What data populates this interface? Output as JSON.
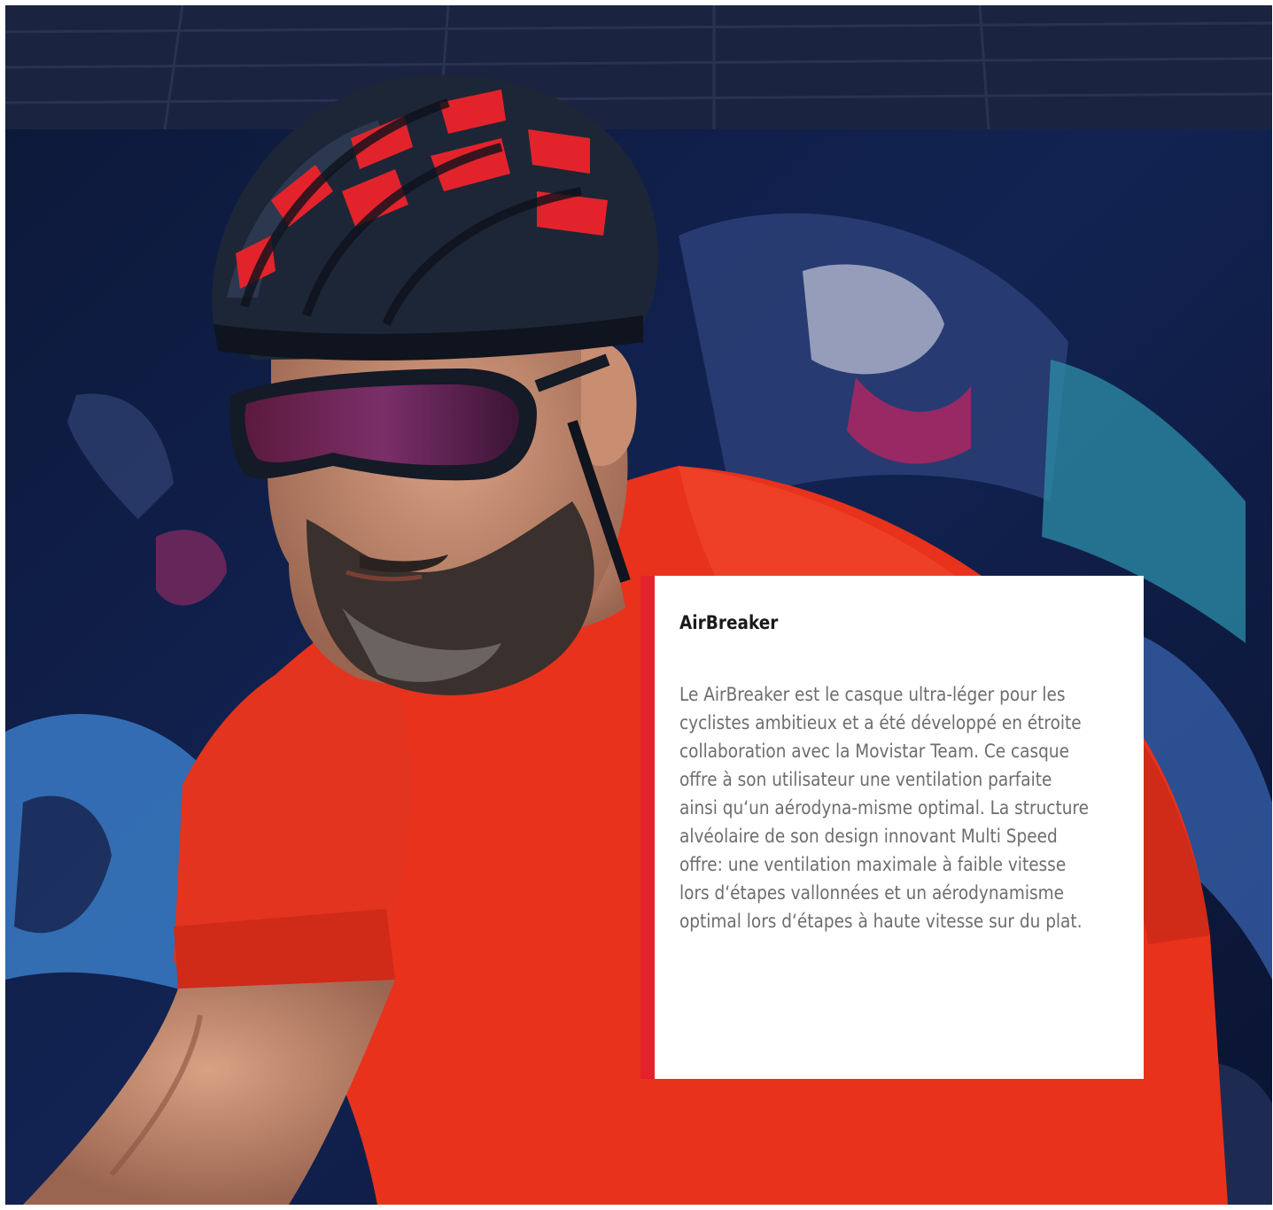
{
  "colors": {
    "accent": "#e3232b",
    "jersey": "#e8321c",
    "helmet": "#1d2636",
    "background_navy": "#0b1530",
    "card_background": "#ffffff",
    "title_text": "#1a1a1a",
    "body_text": "#6d6d6d"
  },
  "hero": {
    "image_subject": "cyclist-photo"
  },
  "card": {
    "title": "AirBreaker",
    "body": "Le AirBreaker est le casque ultra-léger pour les cyclistes ambitieux et a été développé en étroite collaboration avec la Movistar Team. Ce casque offre à son utilisateur une ventilation parfaite ainsi qu‘un aérodyna-misme optimal. La structure alvéolaire de son design innovant Multi Speed offre: une ventilation maximale à faible vitesse lors d‘étapes vallonnées et un aérodynamisme optimal lors d‘étapes à haute vitesse sur du plat."
  }
}
